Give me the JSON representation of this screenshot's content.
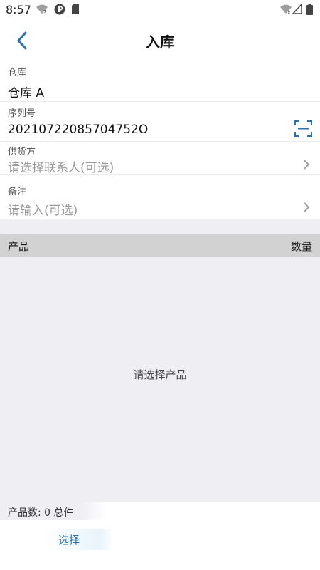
{
  "status_bar": {
    "time": "8:57",
    "left_icons": [
      "wifi-question-icon",
      "app-badge-icon",
      "sim-card-icon"
    ],
    "right_icons": [
      "wifi-x-icon",
      "signal-icon",
      "battery-icon"
    ]
  },
  "header": {
    "title": "入库",
    "back_icon": "chevron-left-icon"
  },
  "form": {
    "warehouse": {
      "label": "仓库",
      "value": "仓库 A"
    },
    "serial": {
      "label": "序列号",
      "value": "20210722085704752O",
      "scan_icon": "scan-icon"
    },
    "supplier": {
      "label": "供货方",
      "placeholder": "请选择联系人(可选)"
    },
    "remark": {
      "label": "备注",
      "placeholder": "请输入(可选)"
    }
  },
  "table": {
    "col_product": "产品",
    "col_quantity": "数量",
    "empty_text": "请选择产品"
  },
  "summary": {
    "text": "产品数: 0   总件"
  },
  "footer": {
    "select_label": "选择"
  },
  "colors": {
    "accent": "#2a6fb0",
    "background": "#eeeef3",
    "header_bg": "#d2d2d2"
  }
}
